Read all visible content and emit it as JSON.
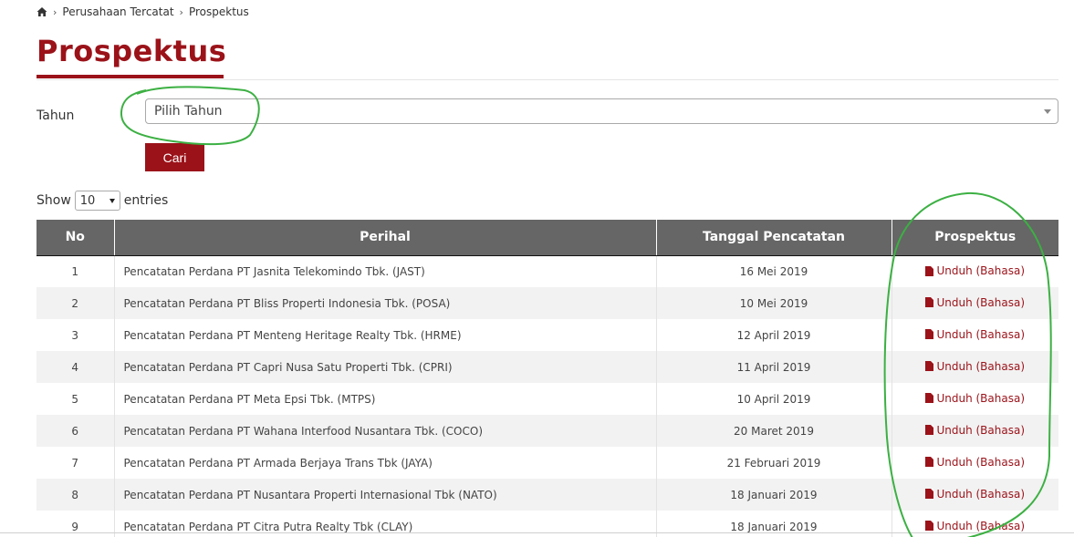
{
  "breadcrumb": {
    "home_icon": "home-icon",
    "items": [
      "Perusahaan Tercatat",
      "Prospektus"
    ]
  },
  "page": {
    "title": "Prospektus"
  },
  "filter": {
    "label": "Tahun",
    "select_value": "Pilih Tahun",
    "button": "Cari"
  },
  "entries": {
    "show": "Show",
    "value": "10",
    "entries": "entries"
  },
  "table": {
    "headers": [
      "No",
      "Perihal",
      "Tanggal Pencatatan",
      "Prospektus"
    ],
    "rows": [
      {
        "no": "1",
        "perihal": "Pencatatan Perdana PT Jasnita Telekomindo Tbk. (JAST)",
        "date": "16 Mei 2019",
        "link": "Unduh (Bahasa)"
      },
      {
        "no": "2",
        "perihal": "Pencatatan Perdana PT Bliss Properti Indonesia Tbk. (POSA)",
        "date": "10 Mei 2019",
        "link": "Unduh (Bahasa)"
      },
      {
        "no": "3",
        "perihal": "Pencatatan Perdana PT Menteng Heritage Realty Tbk. (HRME)",
        "date": "12 April 2019",
        "link": "Unduh (Bahasa)"
      },
      {
        "no": "4",
        "perihal": "Pencatatan Perdana PT Capri Nusa Satu Properti Tbk. (CPRI)",
        "date": "11 April 2019",
        "link": "Unduh (Bahasa)"
      },
      {
        "no": "5",
        "perihal": "Pencatatan Perdana PT Meta Epsi Tbk. (MTPS)",
        "date": "10 April 2019",
        "link": "Unduh (Bahasa)"
      },
      {
        "no": "6",
        "perihal": "Pencatatan Perdana PT Wahana Interfood Nusantara Tbk. (COCO)",
        "date": "20 Maret 2019",
        "link": "Unduh (Bahasa)"
      },
      {
        "no": "7",
        "perihal": "Pencatatan Perdana PT Armada Berjaya Trans Tbk (JAYA)",
        "date": "21 Februari 2019",
        "link": "Unduh (Bahasa)"
      },
      {
        "no": "8",
        "perihal": "Pencatatan Perdana PT Nusantara Properti Internasional Tbk (NATO)",
        "date": "18 Januari 2019",
        "link": "Unduh (Bahasa)"
      },
      {
        "no": "9",
        "perihal": "Pencatatan Perdana PT Citra Putra Realty Tbk (CLAY)",
        "date": "18 Januari 2019",
        "link": "Unduh (Bahasa)"
      }
    ]
  },
  "colors": {
    "brand": "#9b1219",
    "header_bg": "#666666",
    "annotation": "#3cb043"
  }
}
